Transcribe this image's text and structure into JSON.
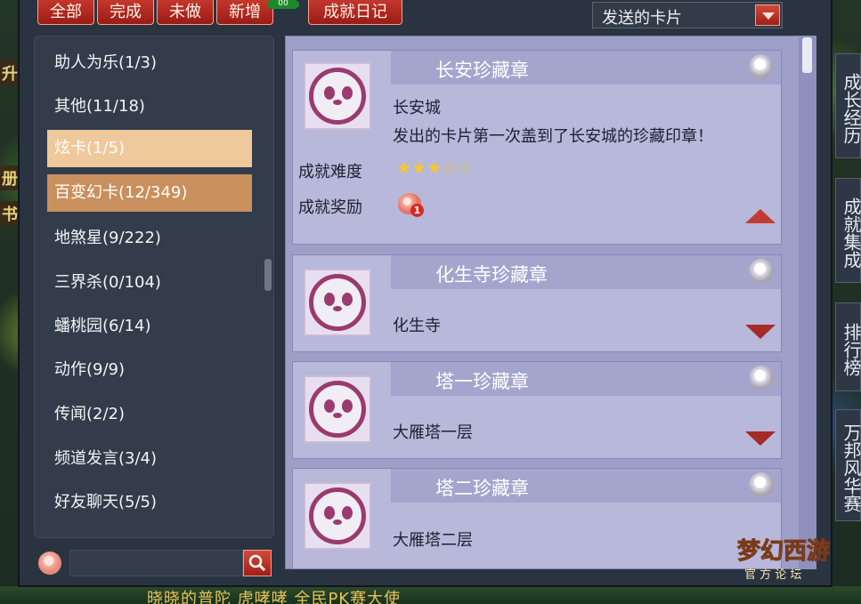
{
  "top_buttons": {
    "all": "全部",
    "done": "完成",
    "todo": "未做",
    "new": "新增",
    "new_badge": "00",
    "diary": "成就日记"
  },
  "dropdown": {
    "selected": "发送的卡片"
  },
  "categories": [
    "助人为乐(1/3)",
    "其他(11/18)",
    "炫卡(1/5)",
    "百变幻卡(12/349)",
    "地煞星(9/222)",
    "三界杀(0/104)",
    "蟠桃园(6/14)",
    "动作(9/9)",
    "传闻(2/2)",
    "频道发言(3/4)",
    "好友聊天(5/5)"
  ],
  "cards": [
    {
      "title": "长安珍藏章",
      "location": "长安城",
      "description": "发出的卡片第一次盖到了长安城的珍藏印章！",
      "difficulty_label": "成就难度",
      "difficulty_stars": "★★★☆☆",
      "reward_label": "成就奖励",
      "reward_count": "1"
    },
    {
      "title": "化生寺珍藏章",
      "location": "化生寺"
    },
    {
      "title": "塔一珍藏章",
      "location": "大雁塔一层"
    },
    {
      "title": "塔二珍藏章",
      "location": "大雁塔二层"
    }
  ],
  "side_tabs": [
    "成长经历",
    "成就集成",
    "排行榜",
    "万邦风华赛"
  ],
  "edge_texts": [
    "升级",
    "册",
    "书"
  ],
  "bottom_names": "晓晓的普陀   虎哮哮   全民PK赛大使",
  "logo": "梦幻西游",
  "logo_sub": "官方论坛"
}
